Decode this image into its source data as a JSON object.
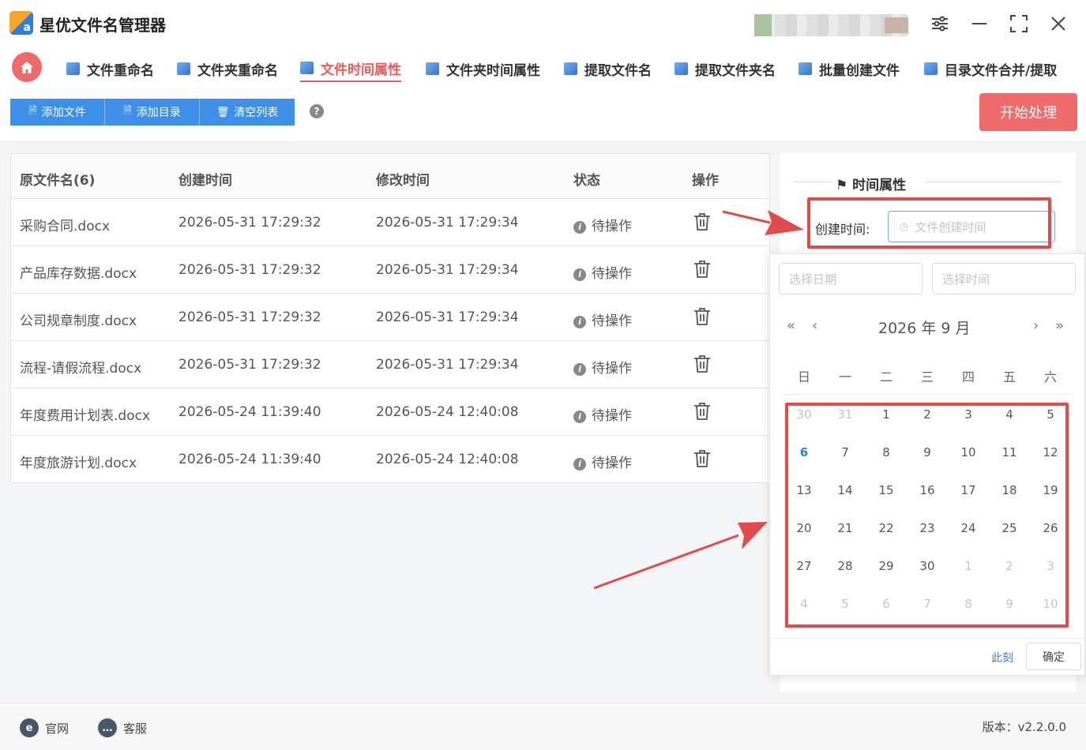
{
  "app": {
    "title": "星优文件名管理器",
    "logo_letter": "a"
  },
  "window_controls": [
    "settings-icon",
    "minimize-icon",
    "maximize-icon",
    "close-icon"
  ],
  "nav": {
    "tabs": [
      {
        "label": "文件重命名",
        "active": false
      },
      {
        "label": "文件夹重命名",
        "active": false
      },
      {
        "label": "文件时间属性",
        "active": true
      },
      {
        "label": "文件夹时间属性",
        "active": false
      },
      {
        "label": "提取文件名",
        "active": false
      },
      {
        "label": "提取文件夹名",
        "active": false
      },
      {
        "label": "批量创建文件",
        "active": false
      },
      {
        "label": "目录文件合并/提取",
        "active": false
      }
    ]
  },
  "toolbar": {
    "add_file": "添加文件",
    "add_dir": "添加目录",
    "clear_list": "清空列表",
    "help": "?",
    "start": "开始处理"
  },
  "table": {
    "headers": {
      "name": "原文件名(6)",
      "created": "创建时间",
      "modified": "修改时间",
      "status": "状态",
      "action": "操作"
    },
    "rows": [
      {
        "name": "采购合同.docx",
        "created": "2026-05-31 17:29:32",
        "modified": "2026-05-31 17:29:34",
        "status": "待操作"
      },
      {
        "name": "产品库存数据.docx",
        "created": "2026-05-31 17:29:32",
        "modified": "2026-05-31 17:29:34",
        "status": "待操作"
      },
      {
        "name": "公司规章制度.docx",
        "created": "2026-05-31 17:29:32",
        "modified": "2026-05-31 17:29:34",
        "status": "待操作"
      },
      {
        "name": "流程-请假流程.docx",
        "created": "2026-05-31 17:29:32",
        "modified": "2026-05-31 17:29:34",
        "status": "待操作"
      },
      {
        "name": "年度费用计划表.docx",
        "created": "2026-05-24 11:39:40",
        "modified": "2026-05-24 12:40:08",
        "status": "待操作"
      },
      {
        "name": "年度旅游计划.docx",
        "created": "2026-05-24 11:39:40",
        "modified": "2026-05-24 12:40:08",
        "status": "待操作"
      }
    ]
  },
  "panel": {
    "title": "时间属性",
    "create_time_label": "创建时间:",
    "create_time_placeholder": "文件创建时间"
  },
  "picker": {
    "date_placeholder": "选择日期",
    "time_placeholder": "选择时间",
    "header": "2026 年  9 月",
    "weekdays": [
      "日",
      "一",
      "二",
      "三",
      "四",
      "五",
      "六"
    ],
    "weeks": [
      [
        {
          "d": "30",
          "o": true
        },
        {
          "d": "31",
          "o": true
        },
        {
          "d": "1"
        },
        {
          "d": "2"
        },
        {
          "d": "3"
        },
        {
          "d": "4"
        },
        {
          "d": "5"
        }
      ],
      [
        {
          "d": "6",
          "today": true
        },
        {
          "d": "7"
        },
        {
          "d": "8"
        },
        {
          "d": "9"
        },
        {
          "d": "10"
        },
        {
          "d": "11"
        },
        {
          "d": "12"
        }
      ],
      [
        {
          "d": "13"
        },
        {
          "d": "14"
        },
        {
          "d": "15"
        },
        {
          "d": "16"
        },
        {
          "d": "17"
        },
        {
          "d": "18"
        },
        {
          "d": "19"
        }
      ],
      [
        {
          "d": "20"
        },
        {
          "d": "21"
        },
        {
          "d": "22"
        },
        {
          "d": "23"
        },
        {
          "d": "24"
        },
        {
          "d": "25"
        },
        {
          "d": "26"
        }
      ],
      [
        {
          "d": "27"
        },
        {
          "d": "28"
        },
        {
          "d": "29"
        },
        {
          "d": "30"
        },
        {
          "d": "1",
          "o": true
        },
        {
          "d": "2",
          "o": true
        },
        {
          "d": "3",
          "o": true
        }
      ],
      [
        {
          "d": "4",
          "o": true
        },
        {
          "d": "5",
          "o": true
        },
        {
          "d": "6",
          "o": true
        },
        {
          "d": "7",
          "o": true
        },
        {
          "d": "8",
          "o": true
        },
        {
          "d": "9",
          "o": true
        },
        {
          "d": "10",
          "o": true
        }
      ]
    ],
    "now": "此刻",
    "confirm": "确定"
  },
  "footer": {
    "website": "官网",
    "support": "客服",
    "version": "版本：v2.2.0.0"
  },
  "colors": {
    "accent": "#ef5a5a",
    "primary": "#3d8fe8",
    "annotation": "#e34b4b"
  }
}
